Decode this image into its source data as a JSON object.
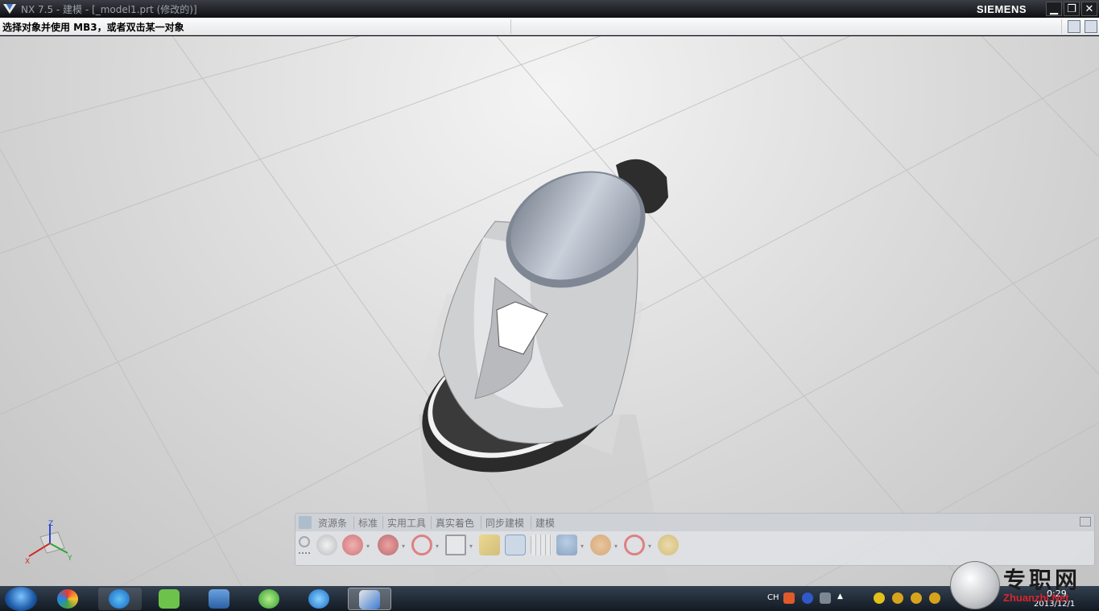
{
  "window": {
    "title": "NX 7.5 - 建模 - [_model1.prt (修改的)]",
    "brand": "SIEMENS",
    "minimize_label": "▁",
    "maximize_label": "❐",
    "close_label": "✕"
  },
  "cue_line": {
    "prompt": "选择对象并使用 MB3，或者双击某一对象"
  },
  "viewport": {
    "axis_labels": {
      "x": "X",
      "y": "Y",
      "z": "Z"
    },
    "background_colors": [
      "#f4f4f4",
      "#c3c3c3"
    ],
    "model": "electric-kettle"
  },
  "ribbon": {
    "tabs": [
      {
        "label": "资源条"
      },
      {
        "label": "标准"
      },
      {
        "label": "实用工具"
      },
      {
        "label": "真实着色"
      },
      {
        "label": "同步建模"
      },
      {
        "label": "建模"
      }
    ],
    "icons": [
      "sphere-render-icon",
      "red-sphere-icon",
      "red-ball-icon",
      "no-symbol-icon",
      "frame-icon",
      "pencil-icon",
      "person-icon",
      "grid-icon",
      "user-icon",
      "orbit-icon",
      "stop-icon",
      "search-icon"
    ]
  },
  "taskbar": {
    "apps": [
      {
        "name": "kuwo",
        "icon": "colorful-app-icon"
      },
      {
        "name": "k-app",
        "icon": "k-icon"
      },
      {
        "name": "iqiyi",
        "icon": "iqiyi-icon"
      },
      {
        "name": "files",
        "icon": "film-icon"
      },
      {
        "name": "360",
        "icon": "green-globe-icon"
      },
      {
        "name": "player",
        "icon": "play-icon"
      },
      {
        "name": "nx",
        "icon": "nx-icon"
      }
    ],
    "tray": {
      "lang": "CH",
      "time": "0:29",
      "date": "2013/12/1"
    }
  },
  "watermark": {
    "cn": "专职网",
    "en": "Zhuanzhi.Net"
  }
}
